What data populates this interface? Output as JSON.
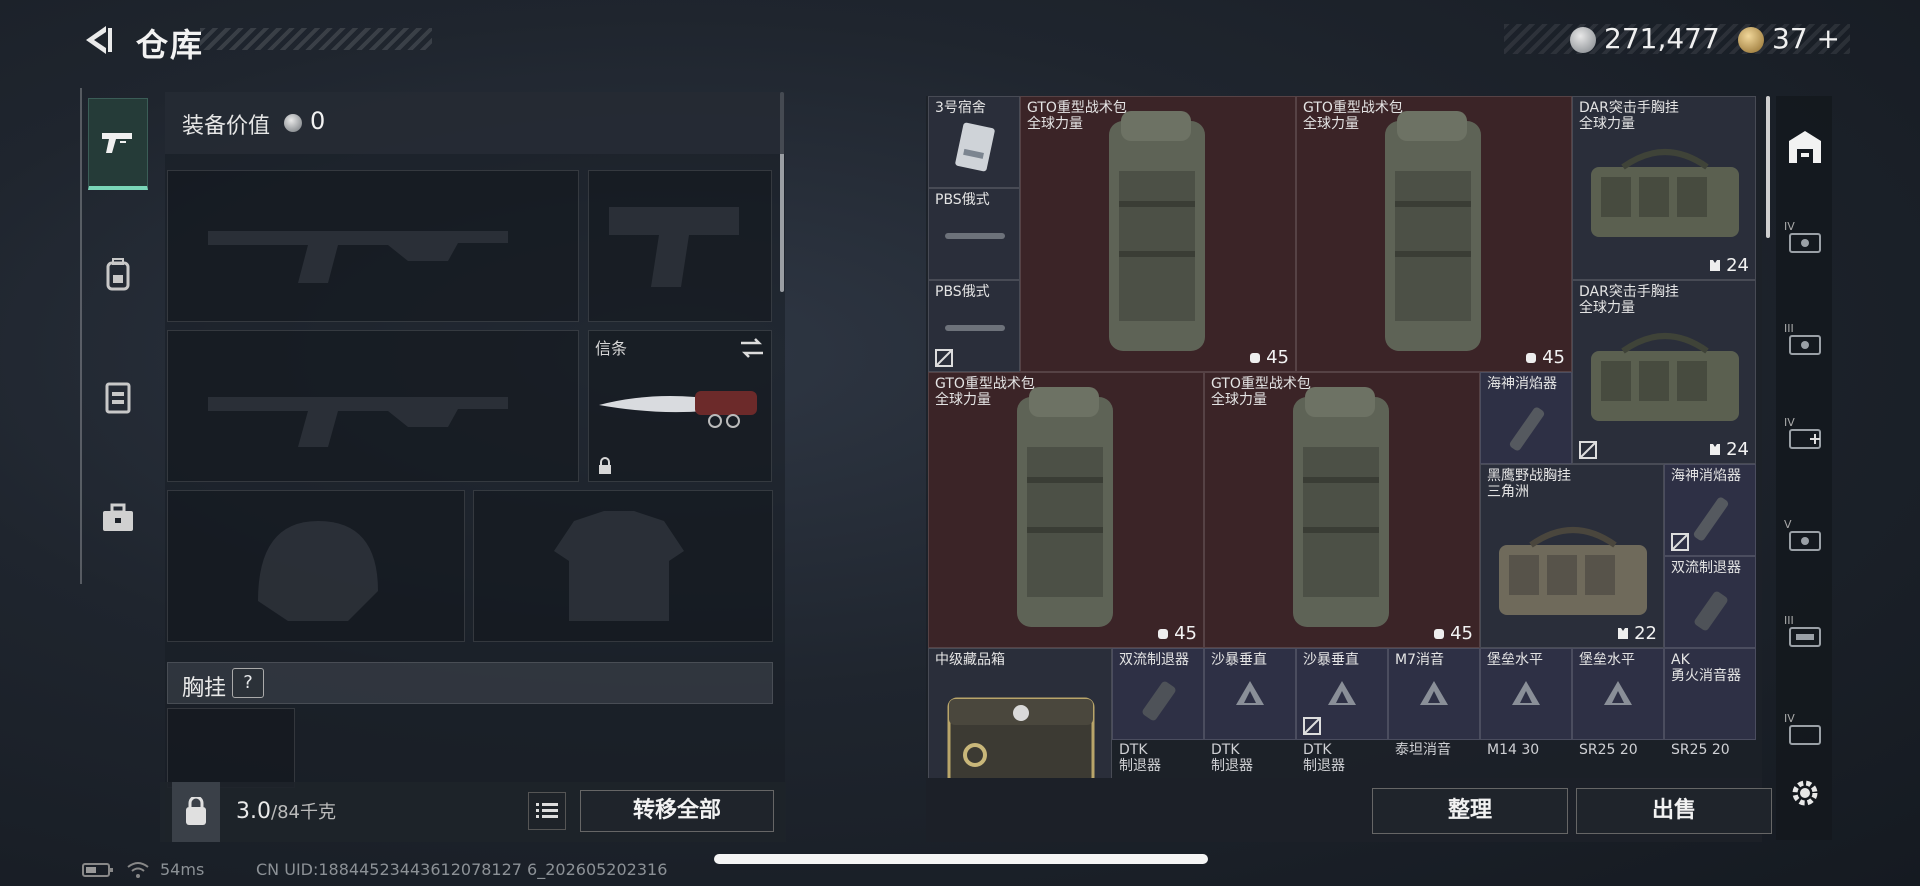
{
  "header": {
    "title": "仓库",
    "currency1": "271,477",
    "currency2": "37",
    "plus": "+"
  },
  "left_sidebar": {
    "tabs": [
      {
        "icon": "pistol-icon",
        "active": true
      },
      {
        "icon": "backpack-icon",
        "active": false
      },
      {
        "icon": "vest-icon",
        "active": false
      },
      {
        "icon": "toolbox-icon",
        "active": false
      }
    ]
  },
  "equipment": {
    "value_label": "装备价值",
    "value": "0",
    "melee_label": "信条",
    "chest_label": "胸挂",
    "help": "?",
    "weight": "3.0",
    "weight_max": "/84千克",
    "transfer_all": "转移全部"
  },
  "grid": {
    "items": [
      {
        "id": "keycard",
        "name": "3号宿舍",
        "style": "dark"
      },
      {
        "id": "gto1",
        "name": "GTO重型战术包\n全球力量",
        "qty": "45",
        "style": "red"
      },
      {
        "id": "gto2",
        "name": "GTO重型战术包\n全球力量",
        "qty": "45",
        "style": "red"
      },
      {
        "id": "dar1",
        "name": "DAR突击手胸挂\n全球力量",
        "qty": "24",
        "style": "dark"
      },
      {
        "id": "pbs1",
        "name": "PBS俄式",
        "style": "dark"
      },
      {
        "id": "pbs2",
        "name": "PBS俄式",
        "style": "dark"
      },
      {
        "id": "dar2",
        "name": "DAR突击手胸挂\n全球力量",
        "qty": "24",
        "style": "dark"
      },
      {
        "id": "gto3",
        "name": "GTO重型战术包\n全球力量",
        "qty": "45",
        "style": "red"
      },
      {
        "id": "gto4",
        "name": "GTO重型战术包\n全球力量",
        "qty": "45",
        "style": "red"
      },
      {
        "id": "hs1",
        "name": "海神消焰器",
        "style": "purple"
      },
      {
        "id": "blackhawk",
        "name": "黑鹰野战胸挂\n三角洲",
        "qty": "22",
        "style": "dark"
      },
      {
        "id": "hs2",
        "name": "海神消焰器",
        "style": "purple"
      },
      {
        "id": "sl1",
        "name": "双流制退器",
        "style": "purple"
      },
      {
        "id": "box",
        "name": "中级藏品箱",
        "style": "dark"
      },
      {
        "id": "sl2",
        "name": "双流制退器",
        "lower": "DTK\n制退器",
        "style": "purple"
      },
      {
        "id": "sb1",
        "name": "沙暴垂直",
        "lower": "DTK\n制退器",
        "style": "purple"
      },
      {
        "id": "sb2",
        "name": "沙暴垂直",
        "lower": "DTK\n制退器",
        "style": "purple"
      },
      {
        "id": "m7",
        "name": "M7消音",
        "lower": "泰坦消音",
        "style": "purple"
      },
      {
        "id": "bl1",
        "name": "堡垒水平",
        "lower": "M14 30",
        "style": "purple"
      },
      {
        "id": "bl2",
        "name": "堡垒水平",
        "lower": "SR25 20",
        "style": "purple"
      },
      {
        "id": "ak",
        "name": "AK\n勇火消音器",
        "lower": "SR25 20",
        "style": "purple"
      }
    ]
  },
  "actions": {
    "sort": "整理",
    "sell": "出售"
  },
  "right_sidebar": {
    "icons": [
      "storage-icon",
      "tier-iv-icon",
      "tier-iii-icon",
      "tier-iv-plus-icon",
      "tier-v-icon",
      "tier-iii-b-icon",
      "tier-iv-b-icon",
      "settings-icon"
    ],
    "labels": [
      "IV",
      "III",
      "IV",
      "V",
      "III",
      "IV"
    ]
  },
  "status_bar": {
    "ping": "54ms",
    "uid": "CN UID:18844523443612078127 6_202605202316"
  },
  "colors": {
    "accent": "#7ad6b8",
    "red_cell": "#3b2427",
    "purple_cell": "#2e3045"
  }
}
